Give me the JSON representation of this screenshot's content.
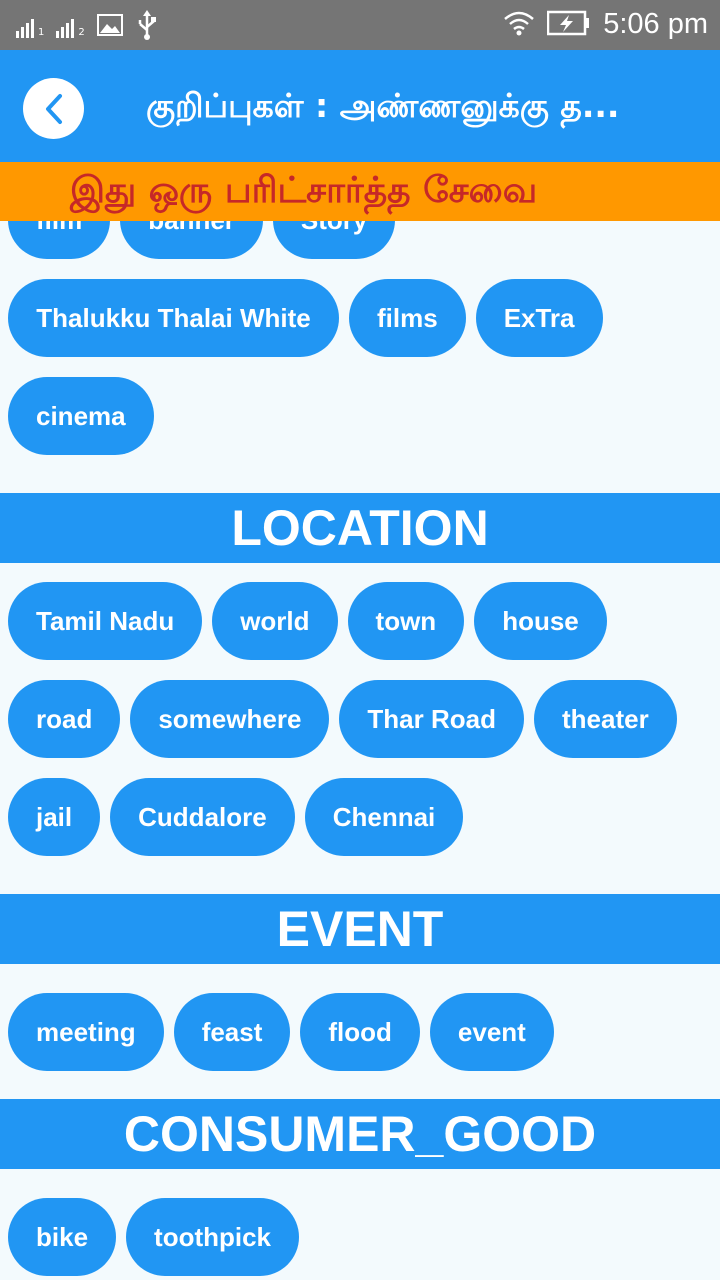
{
  "status_bar": {
    "signal1_sub": "1",
    "signal2_sub": "2",
    "time": "5:06 pm"
  },
  "app_bar": {
    "title": "குறிப்புகள் : அண்ணனுக்கு த..."
  },
  "banner": {
    "text": "இது ஒரு பரிட்சார்த்த சேவை"
  },
  "groups": {
    "top": [
      "film",
      "banner",
      "Story",
      "Thalukku Thalai White",
      "films",
      "ExTra",
      "cinema"
    ],
    "location": {
      "title": "LOCATION",
      "items": [
        "Tamil Nadu",
        "world",
        "town",
        "house",
        "road",
        "somewhere",
        "Thar Road",
        "theater",
        "jail",
        "Cuddalore",
        "Chennai"
      ]
    },
    "event": {
      "title": "EVENT",
      "items": [
        "meeting",
        "feast",
        "flood",
        "event"
      ]
    },
    "consumer_good": {
      "title": "CONSUMER_GOOD",
      "items": [
        "bike",
        "toothpick"
      ]
    }
  },
  "colors": {
    "primary": "#2196f3",
    "status_bar": "#757575",
    "banner_bg": "#ff9800",
    "banner_text": "#c62828",
    "background": "#f3fafd"
  }
}
